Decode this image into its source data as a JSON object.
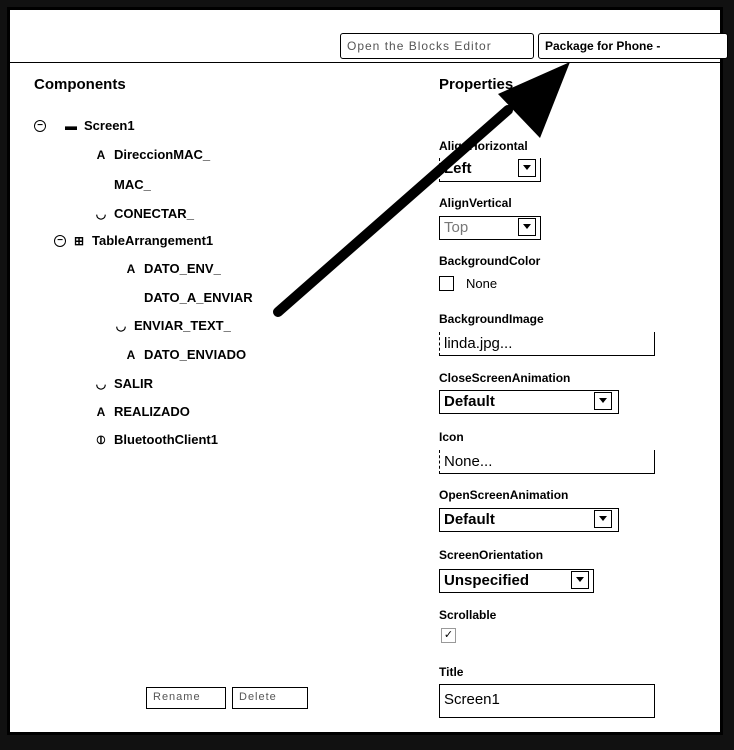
{
  "toolbar": {
    "blocks_editor_label": "Open the Blocks Editor",
    "package_label": "Package for Phone -"
  },
  "components": {
    "title": "Components",
    "items": [
      {
        "label": "Screen1",
        "icon": "screen-icon"
      },
      {
        "label": "DireccionMAC_",
        "icon": "label-icon"
      },
      {
        "label": "MAC_",
        "icon": "textbox-icon"
      },
      {
        "label": "CONECTAR_",
        "icon": "button-icon"
      },
      {
        "label": "TableArrangement1",
        "icon": "table-arrangement-icon"
      },
      {
        "label": "DATO_ENV_",
        "icon": "label-icon"
      },
      {
        "label": "DATO_A_ENVIAR",
        "icon": "textbox-icon"
      },
      {
        "label": "ENVIAR_TEXT_",
        "icon": "button-icon"
      },
      {
        "label": "DATO_ENVIADO",
        "icon": "label-icon"
      },
      {
        "label": "SALIR",
        "icon": "button-icon"
      },
      {
        "label": "REALIZADO",
        "icon": "label-icon"
      },
      {
        "label": "BluetoothClient1",
        "icon": "bluetooth-icon"
      }
    ],
    "rename_label": "Rename",
    "delete_label": "Delete"
  },
  "properties": {
    "title": "Properties",
    "align_horizontal_label": "AlignHorizontal",
    "align_horizontal_value": "Left",
    "align_vertical_label": "AlignVertical",
    "align_vertical_value": "Top",
    "background_color_label": "BackgroundColor",
    "background_color_value": "None",
    "background_image_label": "BackgroundImage",
    "background_image_value": "linda.jpg...",
    "close_anim_label": "CloseScreenAnimation",
    "close_anim_value": "Default",
    "icon_label": "Icon",
    "icon_value": "None...",
    "open_anim_label": "OpenScreenAnimation",
    "open_anim_value": "Default",
    "orientation_label": "ScreenOrientation",
    "orientation_value": "Unspecified",
    "scrollable_label": "Scrollable",
    "title_label": "Title",
    "title_value": "Screen1"
  },
  "colors": {
    "arrow": "#000000",
    "background": "#ffffff"
  }
}
